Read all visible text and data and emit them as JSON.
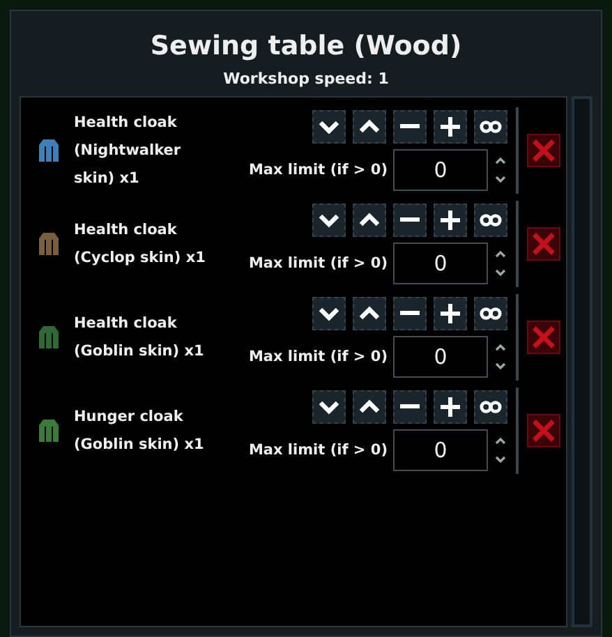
{
  "window": {
    "title": "Sewing table (Wood)",
    "subtitle": "Workshop speed: 1"
  },
  "recipes": [
    {
      "name": "Health cloak (Nightwalker skin) x1",
      "color": "#3f7fb8",
      "limit_label": "Max limit (if > 0)",
      "limit": "0"
    },
    {
      "name": "Health cloak (Cyclop skin) x1",
      "color": "#7a5f3e",
      "limit_label": "Max limit (if > 0)",
      "limit": "0"
    },
    {
      "name": "Health cloak (Goblin skin) x1",
      "color": "#2f6a34",
      "limit_label": "Max limit (if > 0)",
      "limit": "0"
    },
    {
      "name": "Hunger cloak (Goblin skin) x1",
      "color": "#3a7a3a",
      "limit_label": "Max limit (if > 0)",
      "limit": "0"
    }
  ]
}
